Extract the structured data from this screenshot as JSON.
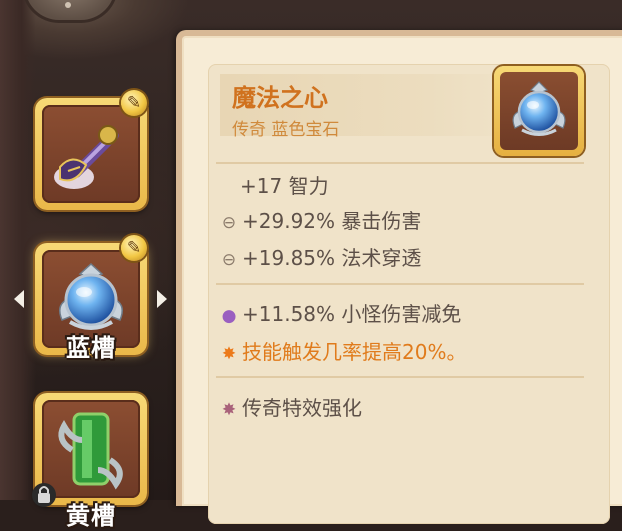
{
  "slots": [
    {
      "name": "weapon",
      "label": "",
      "has_upgrade": true,
      "selected": false
    },
    {
      "name": "blue-slot",
      "label": "蓝槽",
      "has_upgrade": true,
      "selected": true
    },
    {
      "name": "yellow-slot",
      "label": "黄槽",
      "has_upgrade": false,
      "selected": false
    }
  ],
  "item": {
    "name": "魔法之心",
    "subtitle": "传奇 蓝色宝石",
    "icon": "blue-gem-icon"
  },
  "stats": {
    "base": {
      "text": "+17 智力"
    },
    "sub1": {
      "icon": "hollow-circle-icon",
      "text": "+29.92% 暴击伤害"
    },
    "sub2": {
      "icon": "hollow-circle-icon",
      "text": "+19.85% 法术穿透"
    },
    "bonus": {
      "icon": "lock-icon",
      "text": "+11.58% 小怪伤害减免"
    },
    "effect": {
      "icon": "star-burst-icon",
      "text": "技能触发几率提高20%。"
    },
    "legendary": {
      "icon": "star-burst-icon",
      "text": "传奇特效强化"
    }
  },
  "colors": {
    "item_name": "#d0721e",
    "effect_text": "#e07b1c",
    "panel_bg": "#f7ecd6",
    "slot_frame": "#eab849"
  }
}
